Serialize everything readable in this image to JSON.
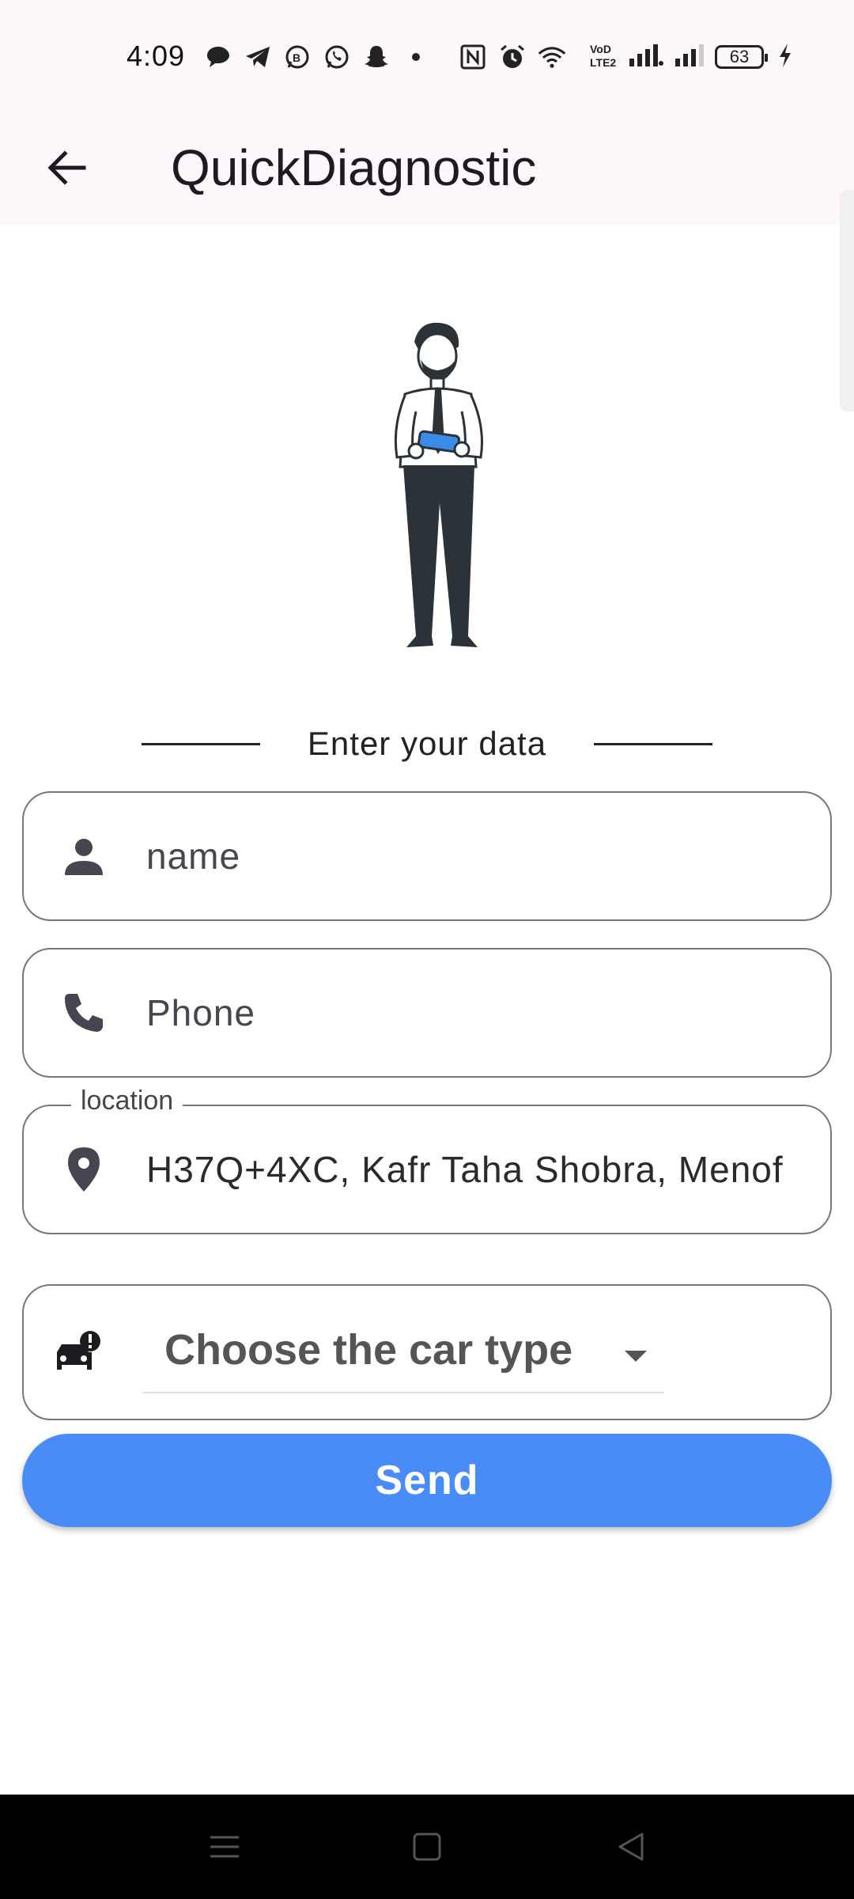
{
  "status_bar": {
    "time": "4:09",
    "battery": "63",
    "icons": [
      "chat-bubble-icon",
      "telegram-icon",
      "whatsapp-business-icon",
      "whatsapp-icon",
      "snapchat-icon",
      "dot-icon",
      "nfc-icon",
      "alarm-icon",
      "wifi-icon",
      "volte-icon",
      "signal-icon",
      "signal-icon",
      "battery-icon",
      "charging-icon"
    ]
  },
  "app_bar": {
    "title": "QuickDiagnostic",
    "back_icon": "arrow-back-icon"
  },
  "form": {
    "heading": "Enter your data",
    "name": {
      "placeholder": "name",
      "icon": "person-icon"
    },
    "phone": {
      "placeholder": "Phone",
      "icon": "phone-icon"
    },
    "location": {
      "label": "location",
      "value": "H37Q+4XC, Kafr Taha Shobra, Menof",
      "icon": "location-pin-icon"
    },
    "car_type": {
      "placeholder": "Choose the car type",
      "icon": "car-alert-icon"
    },
    "send_label": "Send"
  },
  "colors": {
    "primary": "#4a8cf7",
    "app_bar_bg": "#fdf7fb",
    "outline": "#79747e",
    "text": "#1d1b20"
  }
}
